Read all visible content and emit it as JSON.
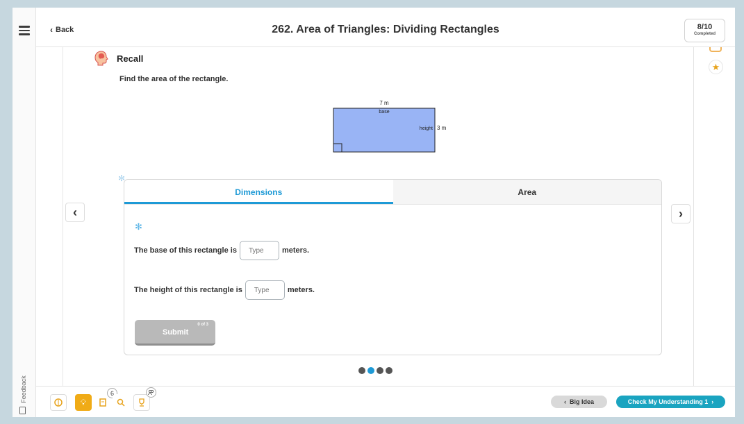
{
  "header": {
    "back_label": "Back",
    "title": "262. Area of Triangles: Dividing Rectangles",
    "progress_count": "8/10",
    "progress_label": "Completed"
  },
  "sidebar": {
    "feedback_label": "Feedback"
  },
  "recall": {
    "title": "Recall",
    "instruction": "Find the area of the rectangle."
  },
  "diagram": {
    "base_value": "7 m",
    "base_label": "base",
    "height_label": "height",
    "height_value": "3 m",
    "fill_color": "#99b4f5"
  },
  "tabs": [
    {
      "label": "Dimensions",
      "active": true
    },
    {
      "label": "Area",
      "active": false
    }
  ],
  "questions": {
    "base_prefix": "The base of this rectangle is",
    "base_placeholder": "Type",
    "base_suffix": "meters.",
    "height_prefix": "The height of this rectangle is",
    "height_placeholder": "Type",
    "height_suffix": "meters."
  },
  "submit": {
    "label": "Submit",
    "attempts": "0 of 3"
  },
  "pagination": {
    "total": 4,
    "active_index": 1
  },
  "toolbar": {
    "badge_notes": "6",
    "big_idea_label": "Big Idea",
    "check_label": "Check My Understanding 1"
  },
  "colors": {
    "accent_blue": "#1e9ad6",
    "check_button": "#1aa4c0",
    "tool_active": "#f0ab16"
  }
}
